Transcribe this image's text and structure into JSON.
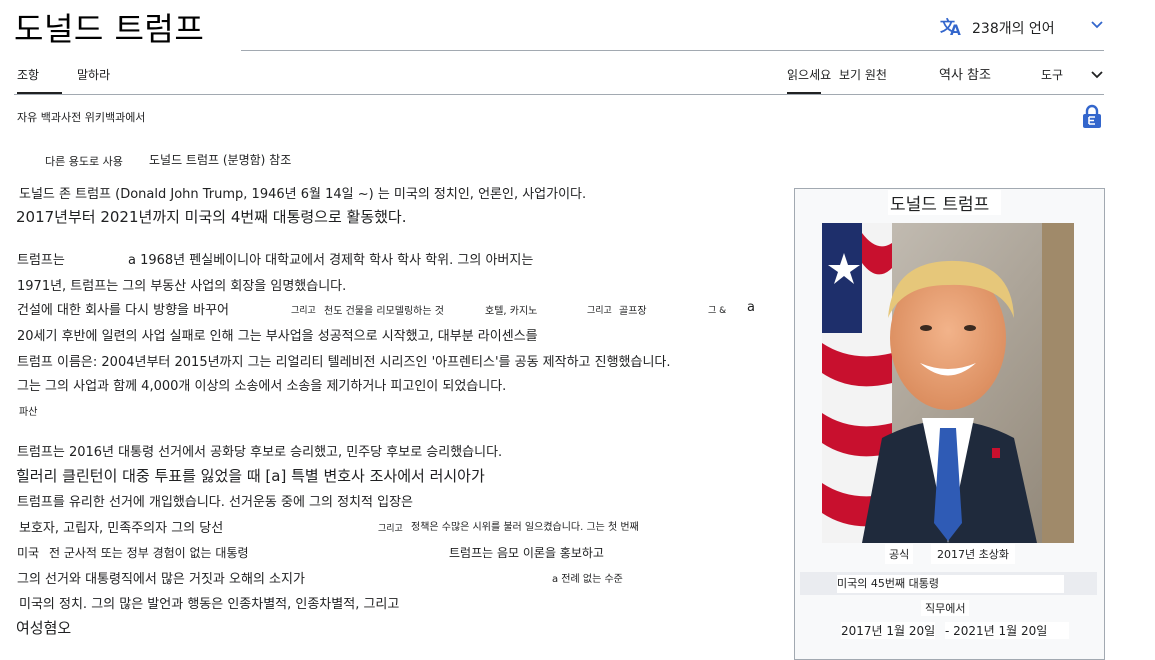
{
  "page": {
    "title": "도널드 트럼프",
    "language_count": "238개의 언어",
    "tabs_left": [
      "조항",
      "말하라"
    ],
    "tabs_right": [
      "읽으세요",
      "보기 원천",
      "역사 참조",
      "도구"
    ],
    "from_line": "자유 백과사전 위키백과에서",
    "hatnote_lead": "다른 용도로 사용",
    "hatnote_link": "도널드 트럼프 (분명함) 참조"
  },
  "body": {
    "l1": "도널드 존 트럼프 (Donald John Trump, 1946년 6월 14일 ~) 는 미국의 정치인, 언론인, 사업가이다.",
    "l2": "2017년부터 2021년까지 미국의 4번째 대통령으로 활동했다.",
    "l3a": "트럼프는",
    "l3b": "a 1968년 펜실베이니아 대학교에서 경제학 학사 학사 학위. 그의 아버지는",
    "l4": "1971년, 트럼프는 그의 부동산 사업의 회장을 임명했습니다.",
    "l5a": "건설에 대한 회사를 다시 방향을 바꾸어",
    "l5b": "그리고",
    "l5c": "천도 건물을 리모델링하는 것",
    "l5d": "호텔, 카지노",
    "l5e": "그리고",
    "l5f": "골프장",
    "l5g": "그 &",
    "l5h": "a",
    "l6": "20세기 후반에 일련의 사업 실패로 인해 그는 부사업을 성공적으로 시작했고, 대부분 라이센스를",
    "l7": "트럼프 이름은: 2004년부터 2015년까지 그는 리얼리티 텔레비전 시리즈인 '아프렌티스'를 공동 제작하고 진행했습니다.",
    "l8": "그는 그의 사업과 함께 4,000개 이상의 소송에서 소송을 제기하거나 피고인이 되었습니다.",
    "l9": "파산",
    "l10": "트럼프는 2016년 대통령 선거에서 공화당 후보로 승리했고, 민주당 후보로 승리했습니다.",
    "l11": "힐러리 클린턴이 대중 투표를 잃었을 때 [a] 특별 변호사 조사에서 러시아가",
    "l12": "트럼프를 유리한 선거에 개입했습니다. 선거운동 중에 그의 정치적 입장은",
    "l13a": "보호자, 고립자, 민족주의자 그의 당선",
    "l13b": "그리고",
    "l13c": "정책은 수많은 시위를 불러 일으켰습니다. 그는 첫 번째",
    "l14a": "미국",
    "l14b": "전 군사적 또는 정부 경험이 없는 대통령",
    "l14c": "트럼프는 음모 이론을 홍보하고",
    "l15a": "그의 선거와 대통령직에서 많은 거짓과 오해의 소지가",
    "l15b": "a 전례 없는 수준",
    "l16": "미국의 정치. 그의 많은 발언과 행동은 인종차별적, 인종차별적, 그리고",
    "l17": "여성혐오"
  },
  "infobox": {
    "title": "도널드 트럼프",
    "caption_a": "공식",
    "caption_b": "2017년 초상화",
    "office": "미국의 45번째 대통령",
    "in_office": "직무에서",
    "date_start": "2017년 1월 20일",
    "date_end": "- 2021년 1월 20일"
  },
  "colors": {
    "accent": "#3366cc",
    "border": "#a2a9b1",
    "text": "#202122",
    "band": "#eaecf0"
  },
  "icons": [
    "translate-icon",
    "chevron-down-icon",
    "lock-icon"
  ]
}
